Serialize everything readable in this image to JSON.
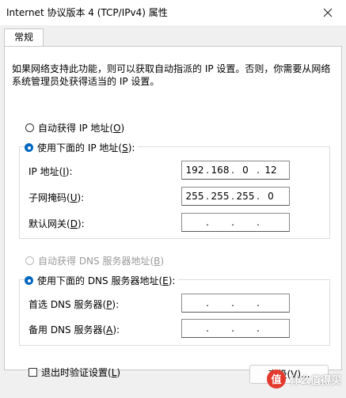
{
  "window": {
    "title": "Internet 协议版本 4 (TCP/IPv4) 属性",
    "close_icon": "close-icon"
  },
  "tabs": [
    {
      "label": "常规"
    }
  ],
  "description": "如果网络支持此功能，则可以获取自动指派的 IP 设置。否则，你需要从网络系统管理员处获得适当的 IP 设置。",
  "ip_section": {
    "auto_option": {
      "label": "自动获得 IP 地址(",
      "key": "O",
      "suffix": ")",
      "selected": false
    },
    "manual_option": {
      "label": "使用下面的 IP 地址(",
      "key": "S",
      "suffix": "):",
      "selected": true
    },
    "fields": [
      {
        "label": "IP 地址(",
        "key": "I",
        "suffix": "):",
        "octets": [
          "192",
          "168",
          "0",
          "12"
        ]
      },
      {
        "label": "子网掩码(",
        "key": "U",
        "suffix": "):",
        "octets": [
          "255",
          "255",
          "255",
          "0"
        ]
      },
      {
        "label": "默认网关(",
        "key": "D",
        "suffix": "):",
        "octets": [
          "",
          "",
          "",
          ""
        ]
      }
    ]
  },
  "dns_section": {
    "auto_option": {
      "label": "自动获得 DNS 服务器地址(",
      "key": "B",
      "suffix": ")",
      "selected": false,
      "disabled": true
    },
    "manual_option": {
      "label": "使用下面的 DNS 服务器地址(",
      "key": "E",
      "suffix": "):",
      "selected": true
    },
    "fields": [
      {
        "label": "首选 DNS 服务器(",
        "key": "P",
        "suffix": "):",
        "octets": [
          "",
          "",
          "",
          ""
        ]
      },
      {
        "label": "备用 DNS 服务器(",
        "key": "A",
        "suffix": "):",
        "octets": [
          "",
          "",
          "",
          ""
        ]
      }
    ]
  },
  "footer": {
    "validate_checkbox": {
      "label": "退出时验证设置(",
      "key": "L",
      "suffix": ")",
      "checked": false
    },
    "advanced_button": {
      "label": "高级(",
      "key": "V",
      "suffix": ")..."
    }
  },
  "watermark": {
    "text": "什么值得买",
    "logo_icon": "smzdm-logo-icon"
  }
}
